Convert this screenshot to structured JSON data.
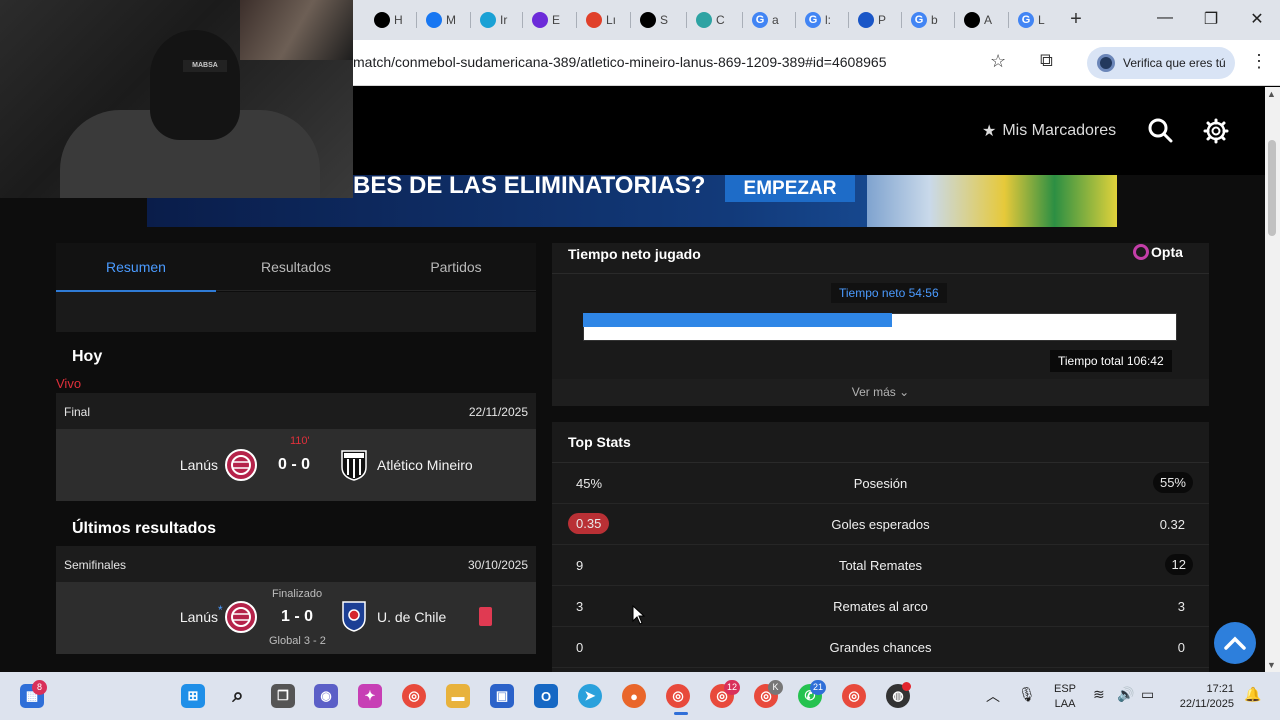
{
  "browser": {
    "tabs": [
      {
        "letter": "",
        "label": "H",
        "color": "#000000"
      },
      {
        "letter": "",
        "label": "M",
        "color": "#1877f2"
      },
      {
        "letter": "",
        "label": "Ir",
        "color": "#1aa1d5"
      },
      {
        "letter": "",
        "label": "E",
        "color": "#6c2bd9"
      },
      {
        "letter": "",
        "label": "Lı",
        "color": "#e0402a"
      },
      {
        "letter": "",
        "label": "S",
        "color": "#000000"
      },
      {
        "letter": "",
        "label": "C",
        "color": "#2ea3a3"
      },
      {
        "letter": "G",
        "label": "a",
        "color": "#4285f4"
      },
      {
        "letter": "G",
        "label": "l:",
        "color": "#4285f4"
      },
      {
        "letter": "",
        "label": "P",
        "color": "#1a56c7"
      },
      {
        "letter": "G",
        "label": "b",
        "color": "#4285f4"
      },
      {
        "letter": "",
        "label": "A",
        "color": "#000000"
      },
      {
        "letter": "G",
        "label": "L",
        "color": "#4285f4"
      }
    ],
    "url": "match/conmebol-sudamericana-389/atletico-mineiro-lanus-869-1209-389#id=4608965",
    "verify_label": "Verifica que eres tú"
  },
  "webcam": {
    "cap_text": "MABSA"
  },
  "nav": {
    "mis_marcadores": "Mis Marcadores"
  },
  "banner": {
    "text": "BES DE LAS ELIMINATORIAS?",
    "cta": "EMPEZAR"
  },
  "left": {
    "tabs": [
      "Resumen",
      "Resultados",
      "Partidos"
    ],
    "hoy": "Hoy",
    "vivo": "Vivo",
    "today_match": {
      "stage": "Final",
      "date": "22/11/2025",
      "minute": "110'",
      "home": "Lanús",
      "away": "Atlético Mineiro",
      "score": "0 - 0"
    },
    "ultimos": "Últimos resultados",
    "last_match": {
      "stage": "Semifinales",
      "date": "30/10/2025",
      "status": "Finalizado",
      "home": "Lanús",
      "home_mark": "*",
      "away": "U. de Chile",
      "score": "1 - 0",
      "aggregate": "Global 3 - 2"
    }
  },
  "right": {
    "tiempo_title": "Tiempo neto jugado",
    "provider": "Opta",
    "tiempo_neto": "Tiempo neto 54:56",
    "tiempo_total": "Tiempo total 106:42",
    "tiempo_fraction": 0.52,
    "ver_mas": "Ver más",
    "top_stats_title": "Top Stats",
    "stats": [
      {
        "label": "Posesión",
        "home": "45%",
        "away": "55%",
        "hl": "away"
      },
      {
        "label": "Goles esperados",
        "home": "0.35",
        "away": "0.32",
        "hl": "home"
      },
      {
        "label": "Total Remates",
        "home": "9",
        "away": "12",
        "hl": "away"
      },
      {
        "label": "Remates al arco",
        "home": "3",
        "away": "3",
        "hl": ""
      },
      {
        "label": "Grandes chances",
        "home": "0",
        "away": "0",
        "hl": ""
      }
    ]
  },
  "taskbar": {
    "badges": {
      "widgets": "8",
      "chrome2": "12",
      "chrome3": "K",
      "whatsapp": "21"
    },
    "lang": "ESP",
    "layout": "LAA",
    "time": "17:21",
    "date": "22/11/2025"
  }
}
